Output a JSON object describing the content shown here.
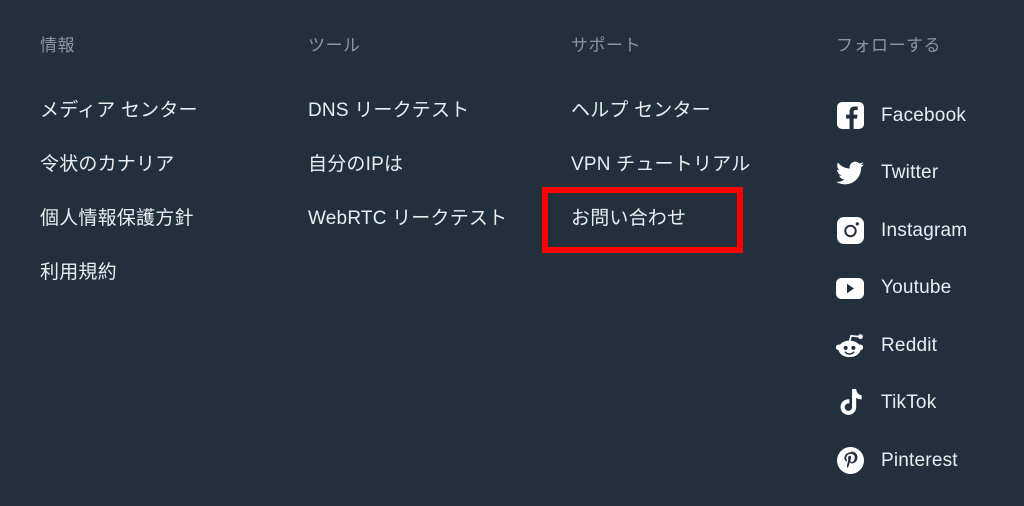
{
  "footer": {
    "background_color": "#222f3d",
    "heading_color": "#8c959d",
    "link_color": "#e9edf0",
    "highlight_color": "#fe0000",
    "columns": [
      {
        "id": "info",
        "heading": "情報",
        "links": [
          {
            "label": "メディア センター"
          },
          {
            "label": "令状のカナリア"
          },
          {
            "label": "個人情報保護方針"
          },
          {
            "label": "利用規約"
          }
        ]
      },
      {
        "id": "tools",
        "heading": "ツール",
        "links": [
          {
            "label": "DNS リークテスト"
          },
          {
            "label": "自分のIPは"
          },
          {
            "label": "WebRTC リークテスト"
          }
        ]
      },
      {
        "id": "support",
        "heading": "サポート",
        "links": [
          {
            "label": "ヘルプ センター"
          },
          {
            "label": "VPN チュートリアル"
          },
          {
            "label": "お問い合わせ",
            "highlighted": true
          }
        ]
      }
    ],
    "follow": {
      "heading": "フォローする",
      "items": [
        {
          "label": "Facebook",
          "icon": "facebook-icon"
        },
        {
          "label": "Twitter",
          "icon": "twitter-icon"
        },
        {
          "label": "Instagram",
          "icon": "instagram-icon"
        },
        {
          "label": "Youtube",
          "icon": "youtube-icon"
        },
        {
          "label": "Reddit",
          "icon": "reddit-icon"
        },
        {
          "label": "TikTok",
          "icon": "tiktok-icon"
        },
        {
          "label": "Pinterest",
          "icon": "pinterest-icon"
        }
      ]
    },
    "annotation": {
      "target_label": "お問い合わせ",
      "shape": "rectangle",
      "color": "#fe0000"
    }
  }
}
